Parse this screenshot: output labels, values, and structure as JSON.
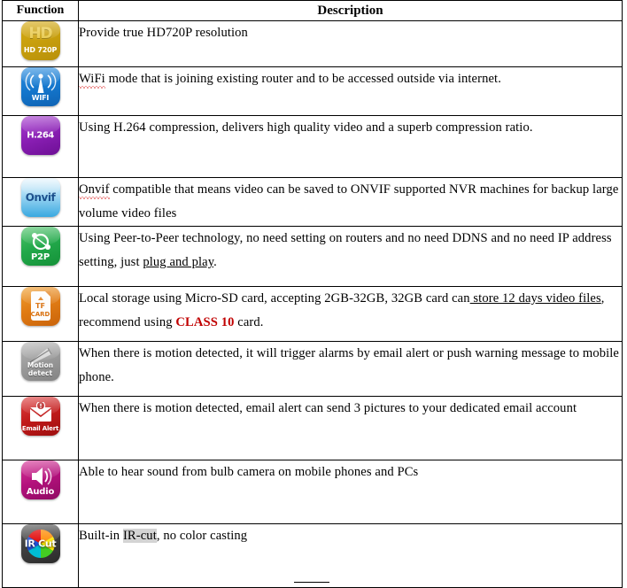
{
  "table": {
    "headers": {
      "function": "Function",
      "description": "Description"
    },
    "rows": [
      {
        "icon_name": "hd-720p-icon",
        "icon_label_top": "HD",
        "icon_label": "HD 720P",
        "icon_color": "#c9a00d",
        "description_lines": [
          "Provide true HD720P resolution"
        ],
        "description": "Provide true HD720P resolution"
      },
      {
        "icon_name": "wifi-icon",
        "icon_label": "WIFI",
        "icon_color": "#1476cc",
        "description_spell_word": "WiFi",
        "description_rest": " mode that is joining existing router and to be accessed outside via internet.",
        "description": "WiFi mode that is joining existing router and to be accessed outside via internet."
      },
      {
        "icon_name": "h264-icon",
        "icon_label": "H.264",
        "icon_color": "#8a1fb4",
        "description": "Using H.264 compression, delivers high quality video and a superb compression ratio."
      },
      {
        "icon_name": "onvif-icon",
        "icon_label": "Onvif",
        "icon_color": "#3aa8e0",
        "description_spell_word": "Onvif",
        "description_rest": " compatible that means video can be saved to ONVIF supported NVR machines for backup large volume video files",
        "description": "Onvif compatible that means video can be saved to ONVIF supported NVR machines for backup large volume video files"
      },
      {
        "icon_name": "p2p-icon",
        "icon_label": "P2P",
        "icon_color": "#22a84a",
        "description_part1": "Using Peer-to-Peer technology, no need setting on routers and no need DDNS and no need IP address setting, just ",
        "description_underlined": "plug and play",
        "description_part2": ".",
        "description": "Using Peer-to-Peer technology, no need setting on routers and no need DDNS and no need IP address setting, just plug and play."
      },
      {
        "icon_name": "tf-card-icon",
        "icon_label_line1": "TF",
        "icon_label_line2": "CARD",
        "icon_color": "#e07b14",
        "description_part1": "Local storage using Micro-SD card, accepting 2GB-32GB, 32GB card can",
        "description_underlined": " store 12 days video files",
        "description_part2": ", recommend using ",
        "description_emphasis": "CLASS 10",
        "description_part3": " card.",
        "description": "Local storage using Micro-SD card, accepting 2GB-32GB, 32GB card can store 12 days video files, recommend using CLASS 10 card."
      },
      {
        "icon_name": "motion-detect-icon",
        "icon_label_line1": "Motion",
        "icon_label_line2": "detect",
        "icon_color": "#9a9a9a",
        "description": "When there is motion detected, it will trigger alarms by email alert or push warning message to mobile phone."
      },
      {
        "icon_name": "email-alert-icon",
        "icon_label": "Email Alert",
        "icon_color": "#c11a1a",
        "description": "When there is motion detected, email alert can send 3 pictures to your dedicated email account"
      },
      {
        "icon_name": "audio-icon",
        "icon_label": "Audio",
        "icon_color": "#b3117c",
        "description": "Able to hear sound from bulb camera on mobile phones and PCs"
      },
      {
        "icon_name": "ir-cut-icon",
        "icon_label": "IR Cut",
        "icon_color": "#3d3d3d",
        "description_part1": "Built-in ",
        "description_highlighted": "IR-cut",
        "description_part2": ", no color casting",
        "description": "Built-in IR-cut, no color casting"
      }
    ]
  },
  "colors": {
    "border": "#000000",
    "emphasis_red": "#c00000",
    "highlight_gray": "#d4d4d4",
    "spellcheck_red": "#dd3333"
  }
}
